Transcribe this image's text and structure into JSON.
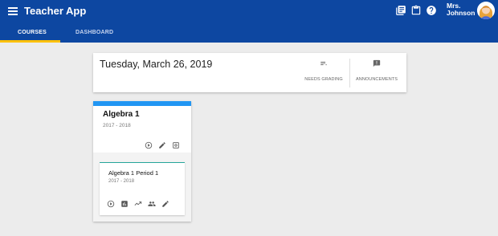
{
  "app": {
    "title": "Teacher App"
  },
  "user": {
    "name_line1": "Mrs.",
    "name_line2": "Johnson"
  },
  "tabs": [
    {
      "label": "COURSES",
      "active": true
    },
    {
      "label": "DASHBOARD",
      "active": false
    }
  ],
  "top_icons": [
    "library-books-icon",
    "clipboard-icon",
    "help-icon"
  ],
  "date_card": {
    "date": "Tuesday, March 26, 2019",
    "actions": [
      {
        "label": "NEEDS GRADING",
        "icon": "needs-grading-icon"
      },
      {
        "label": "ANNOUNCEMENTS",
        "icon": "announcement-icon"
      }
    ]
  },
  "course": {
    "title": "Algebra 1",
    "years": "2017 - 2018",
    "accent": "#2196f3",
    "sections": [
      {
        "title": "Algebra 1 Period 1",
        "years": "2017 - 2018",
        "accent": "#26a69a"
      }
    ]
  },
  "colors": {
    "appbar": "#0d47a1",
    "tab_indicator": "#ffc107",
    "background": "#ececec"
  }
}
